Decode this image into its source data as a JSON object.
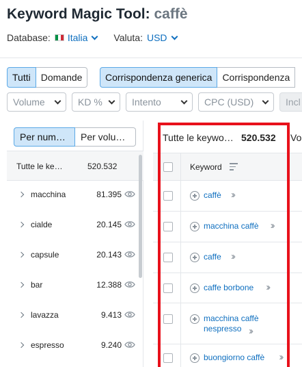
{
  "header": {
    "title": "Keyword Magic Tool:",
    "keyword": "caffè",
    "database_label": "Database:",
    "database_value": "Italia",
    "currency_label": "Valuta:",
    "currency_value": "USD"
  },
  "tabs": {
    "all": "Tutti",
    "questions": "Domande",
    "broad_match": "Corrispondenza generica",
    "match2": "Corrispondenza"
  },
  "filters": [
    "Volume",
    "KD %",
    "Intento",
    "CPC (USD)",
    "Incl"
  ],
  "left_panel": {
    "sort_by_number": "Per num…",
    "sort_by_volume": "Per volu…",
    "all_label": "Tutte le ke…",
    "all_count": "520.532",
    "groups": [
      {
        "name": "macchina",
        "count": "81.395"
      },
      {
        "name": "cialde",
        "count": "20.145"
      },
      {
        "name": "capsule",
        "count": "20.143"
      },
      {
        "name": "bar",
        "count": "12.388"
      },
      {
        "name": "lavazza",
        "count": "9.413"
      },
      {
        "name": "espresso",
        "count": "9.240"
      }
    ]
  },
  "right_panel": {
    "all_label": "Tutte le keywo…",
    "all_count": "520.532",
    "next_col": "Vol",
    "keyword_header": "Keyword",
    "rows": [
      {
        "line1": "caffè",
        "line2": ""
      },
      {
        "line1": "macchina caffè",
        "line2": ""
      },
      {
        "line1": "caffe",
        "line2": ""
      },
      {
        "line1": "caffe borbone",
        "line2": ""
      },
      {
        "line1": "macchina caffè",
        "line2": "nespresso"
      },
      {
        "line1": "buongiorno caffè",
        "line2": ""
      }
    ]
  },
  "colors": {
    "link": "#0d6ebf",
    "active_tab_bg": "#cfe6f9",
    "highlight": "#e8111b"
  }
}
